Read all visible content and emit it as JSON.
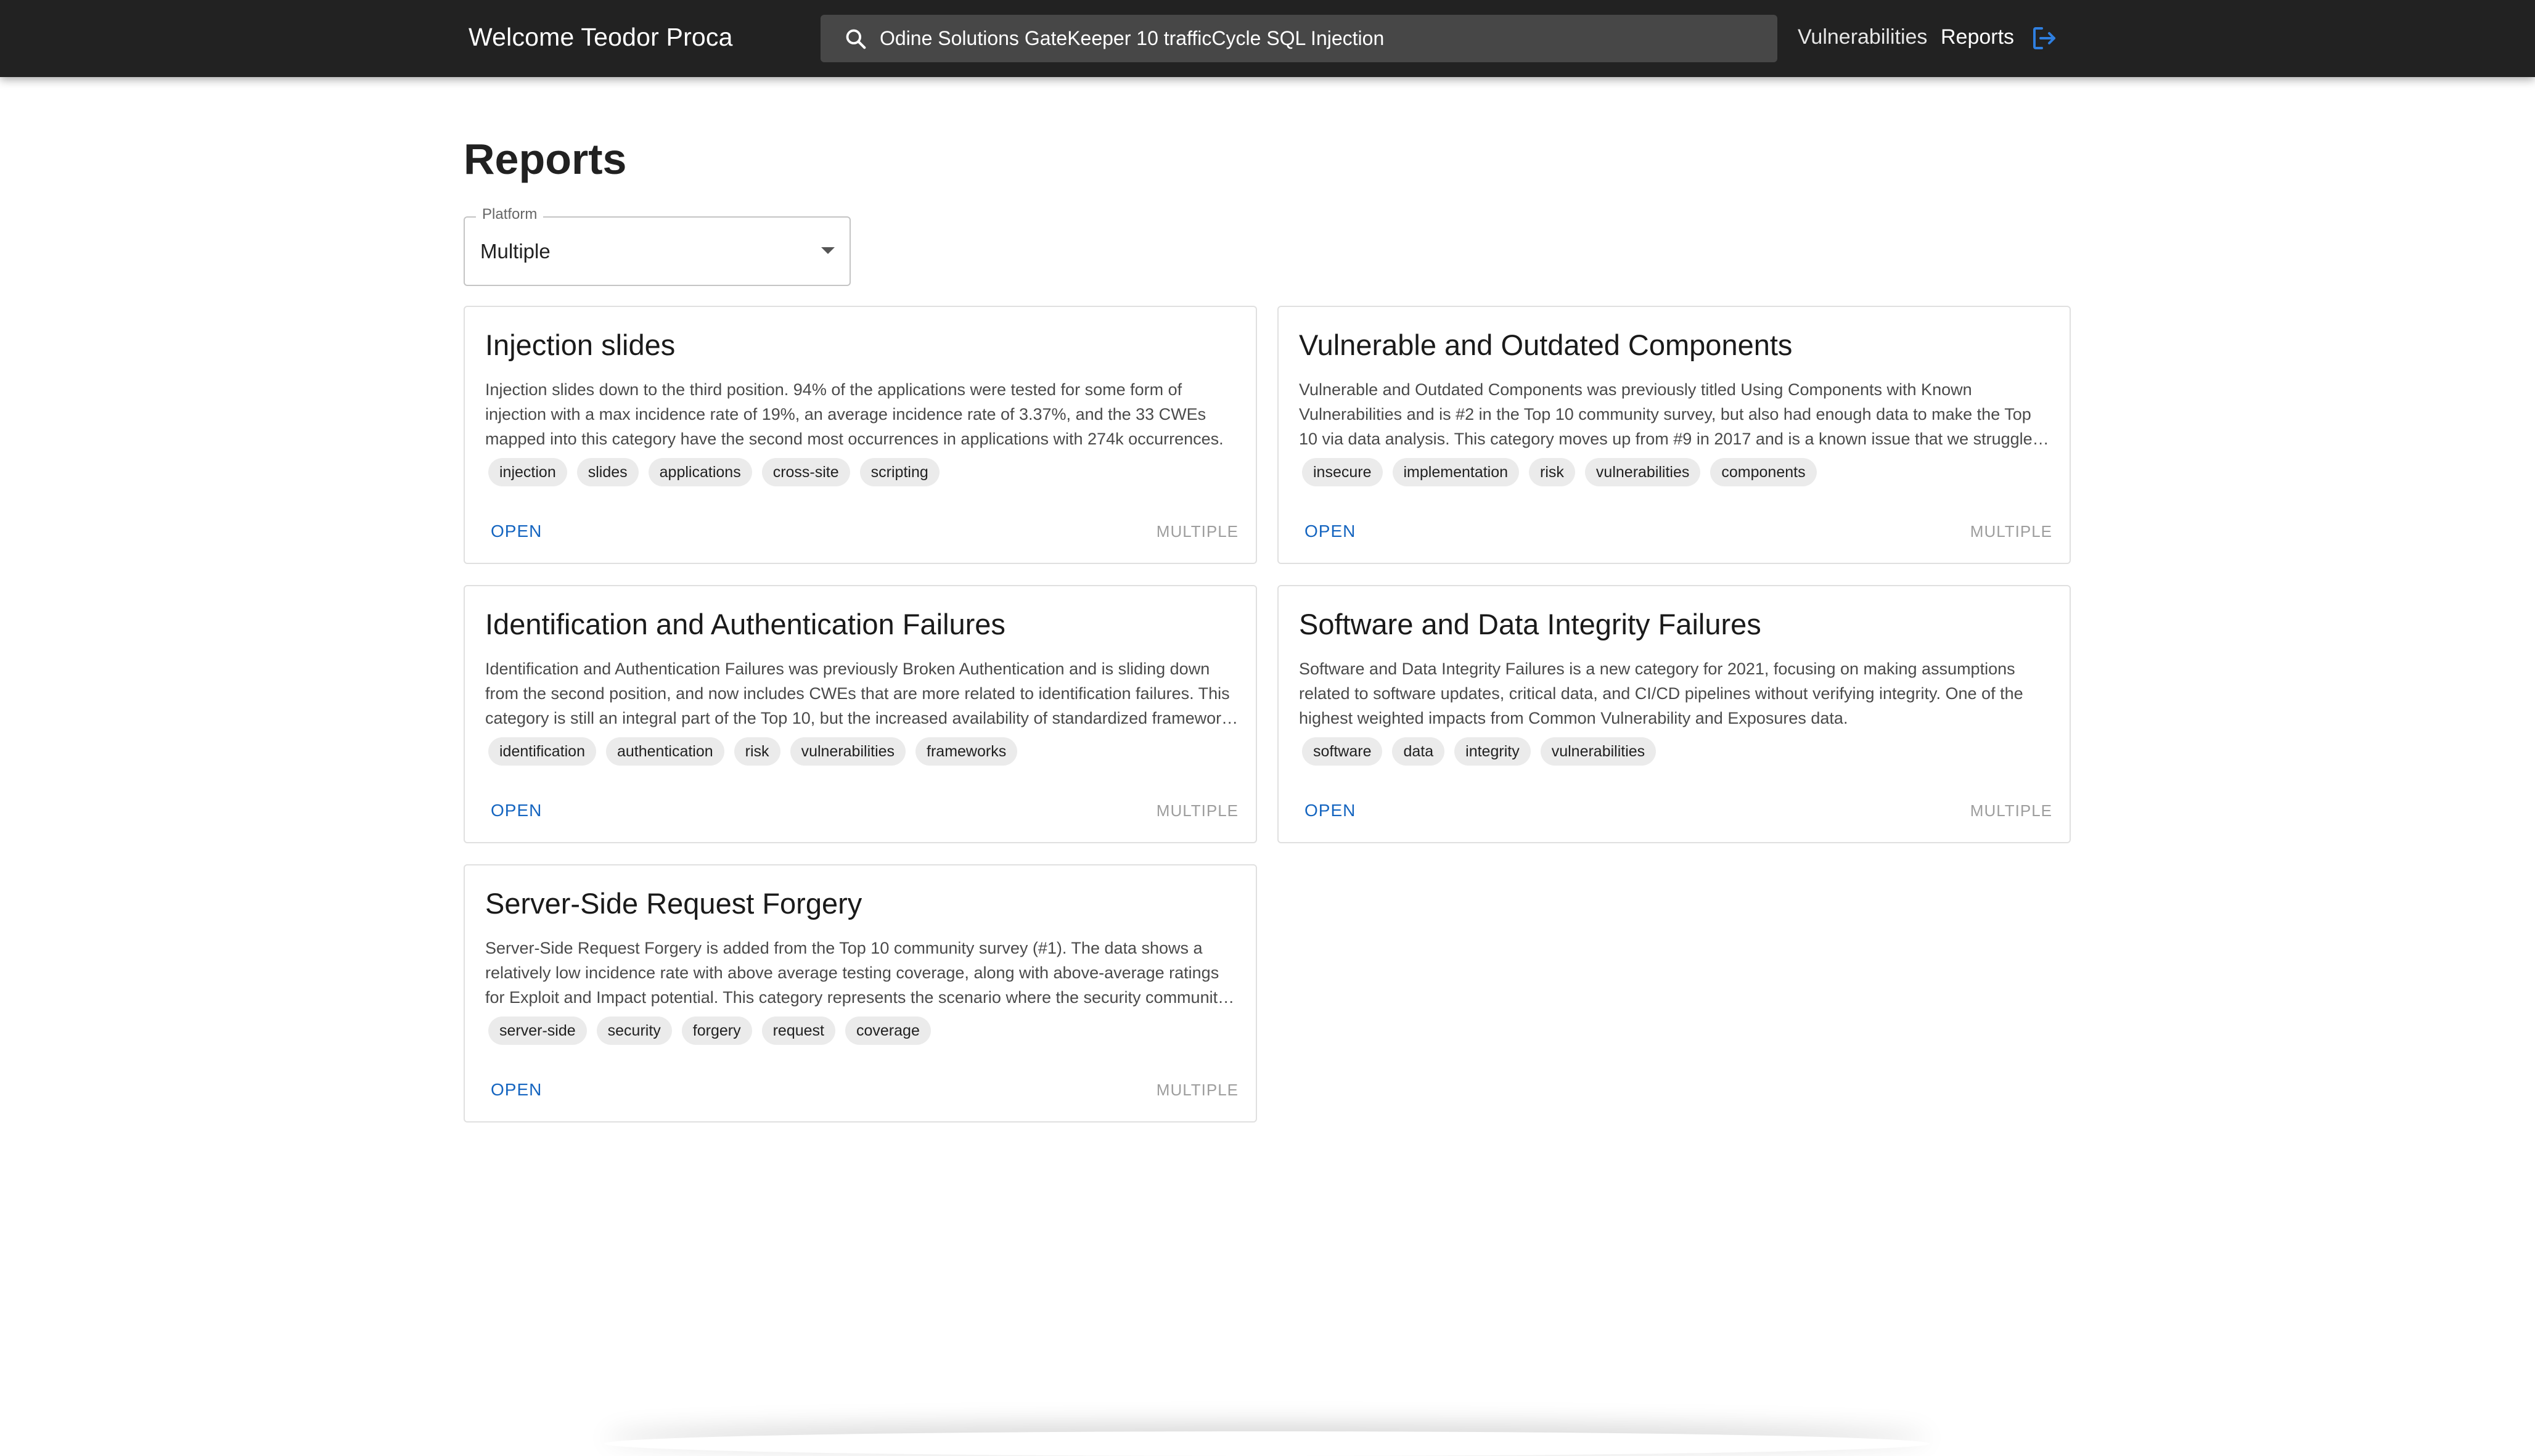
{
  "header": {
    "welcome": "Welcome Teodor Proca",
    "search_value": "Odine Solutions GateKeeper 10 trafficCycle SQL Injection",
    "nav": [
      {
        "label": "Vulnerabilities",
        "active": false
      },
      {
        "label": "Reports",
        "active": true
      }
    ],
    "logout_icon": "logout-icon"
  },
  "page": {
    "title": "Reports",
    "platform_filter": {
      "label": "Platform",
      "value": "Multiple"
    }
  },
  "cards": [
    {
      "title": "Injection slides",
      "description": "Injection slides down to the third position. 94% of the applications were tested for some form of injection with a max incidence rate of 19%, an average incidence rate of 3.37%, and the 33 CWEs mapped into this category have the second most occurrences in applications with 274k occurrences.",
      "tags": [
        "injection",
        "slides",
        "applications",
        "cross-site",
        "scripting"
      ],
      "action": "OPEN",
      "platform": "MULTIPLE"
    },
    {
      "title": "Vulnerable and Outdated Components",
      "description": "Vulnerable and Outdated Components was previously titled Using Components with Known Vulnerabilities and is #2 in the Top 10 community survey, but also had enough data to make the Top 10 via data analysis. This category moves up from #9 in 2017 and is a known issue that we struggle to test and assess risk.",
      "tags": [
        "insecure",
        "implementation",
        "risk",
        "vulnerabilities",
        "components"
      ],
      "action": "OPEN",
      "platform": "MULTIPLE"
    },
    {
      "title": "Identification and Authentication Failures",
      "description": "Identification and Authentication Failures was previously Broken Authentication and is sliding down from the second position, and now includes CWEs that are more related to identification failures. This category is still an integral part of the Top 10, but the increased availability of standardized frameworks seems to be helping.",
      "tags": [
        "identification",
        "authentication",
        "risk",
        "vulnerabilities",
        "frameworks"
      ],
      "action": "OPEN",
      "platform": "MULTIPLE"
    },
    {
      "title": "Software and Data Integrity Failures",
      "description": "Software and Data Integrity Failures is a new category for 2021, focusing on making assumptions related to software updates, critical data, and CI/CD pipelines without verifying integrity. One of the highest weighted impacts from Common Vulnerability and Exposures data.",
      "tags": [
        "software",
        "data",
        "integrity",
        "vulnerabilities"
      ],
      "action": "OPEN",
      "platform": "MULTIPLE"
    },
    {
      "title": "Server-Side Request Forgery",
      "description": "Server-Side Request Forgery is added from the Top 10 community survey (#1). The data shows a relatively low incidence rate with above average testing coverage, along with above-average ratings for Exploit and Impact potential. This category represents the scenario where the security community members are telling us this is important.",
      "tags": [
        "server-side",
        "security",
        "forgery",
        "request",
        "coverage"
      ],
      "action": "OPEN",
      "platform": "MULTIPLE"
    }
  ]
}
